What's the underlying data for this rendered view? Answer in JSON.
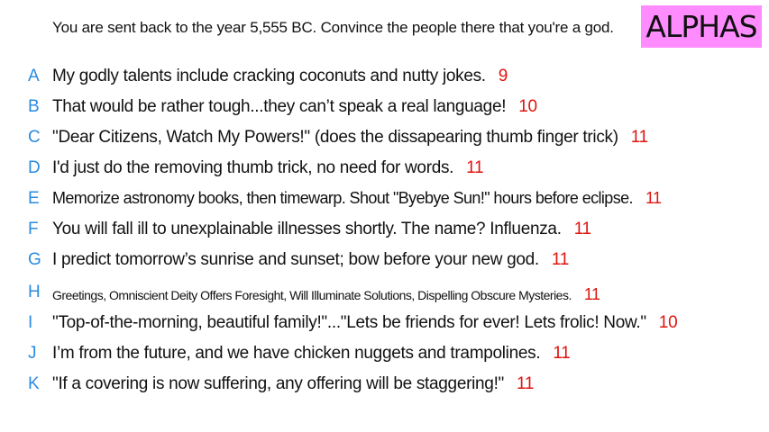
{
  "prompt": "You are sent back to the year 5,555 BC. Convince the people there that you're a god.",
  "badge": "ALPHAS",
  "answers": [
    {
      "letter": "A",
      "text": "My godly talents include cracking coconuts and nutty jokes.",
      "score": "9"
    },
    {
      "letter": "B",
      "text": "That would be rather tough...they can’t speak a real language!",
      "score": "10"
    },
    {
      "letter": "C",
      "text": "\"Dear Citizens, Watch My Powers!\" (does the dissapearing thumb finger trick)",
      "score": "11"
    },
    {
      "letter": "D",
      "text": "I'd just do the removing thumb trick, no need for words.",
      "score": "11"
    },
    {
      "letter": "E",
      "text": "Memorize astronomy books, then timewarp. Shout \"Byebye Sun!\" hours before eclipse.",
      "score": "11"
    },
    {
      "letter": "F",
      "text": "You will fall ill to unexplainable illnesses shortly. The name? Influenza.",
      "score": "11"
    },
    {
      "letter": "G",
      "text": "I predict tomorrow’s sunrise and sunset; bow before your new god.",
      "score": "11"
    },
    {
      "letter": "H",
      "text": "Greetings, Omniscient Deity Offers Foresight, Will Illuminate Solutions, Dispelling Obscure Mysteries.",
      "score": "11"
    },
    {
      "letter": "I",
      "text": "\"Top-of-the-morning, beautiful family!\"...\"Lets be friends for ever! Lets frolic! Now.\"",
      "score": "10"
    },
    {
      "letter": "J",
      "text": "I’m from the future, and we have chicken nuggets and trampolines.",
      "score": "11"
    },
    {
      "letter": "K",
      "text": "\"If a covering is now suffering, any offering will be staggering!\"",
      "score": "11"
    }
  ],
  "colors": {
    "badge_bg": "#ff8cff",
    "letter": "#2a8be0",
    "score": "#e0140f"
  }
}
